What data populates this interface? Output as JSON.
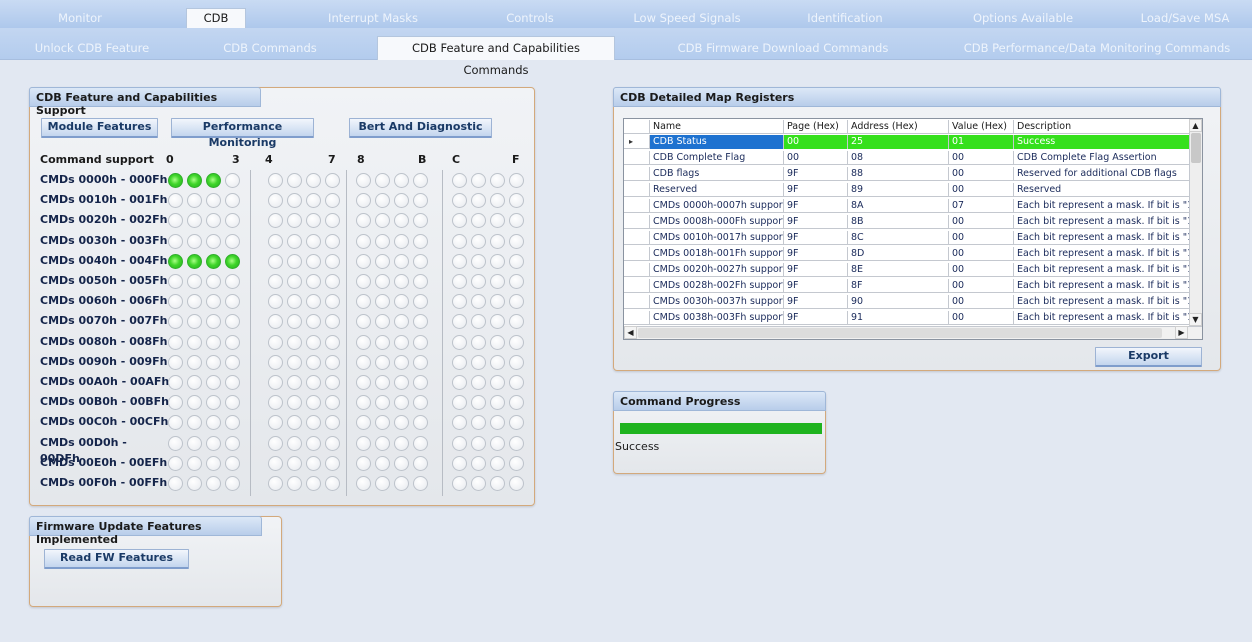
{
  "tabs_top": [
    "Monitor",
    "CDB",
    "Interrupt Masks",
    "Controls",
    "Low Speed Signals",
    "Identification",
    "Options Available",
    "Load/Save MSA"
  ],
  "tabs_sub": [
    "Unlock CDB Feature",
    "CDB Commands",
    "CDB Feature and Capabilities Commands",
    "CDB Firmware Download Commands",
    "CDB Performance/Data Monitoring Commands"
  ],
  "feature_panel": {
    "title": "CDB Feature and Capabilities Support",
    "buttons": [
      "Module Features",
      "Performance Monitoring",
      "Bert And Diagnostic"
    ],
    "header_label": "Command support",
    "col_headers": [
      "0",
      "3",
      "4",
      "7",
      "8",
      "B",
      "C",
      "F"
    ],
    "rows": [
      {
        "label": "CMDs 0000h - 000Fh",
        "bits": [
          1,
          1,
          1,
          0,
          0,
          0,
          0,
          0,
          0,
          0,
          0,
          0,
          0,
          0,
          0,
          0
        ]
      },
      {
        "label": "CMDs 0010h - 001Fh",
        "bits": [
          0,
          0,
          0,
          0,
          0,
          0,
          0,
          0,
          0,
          0,
          0,
          0,
          0,
          0,
          0,
          0
        ]
      },
      {
        "label": "CMDs 0020h - 002Fh",
        "bits": [
          0,
          0,
          0,
          0,
          0,
          0,
          0,
          0,
          0,
          0,
          0,
          0,
          0,
          0,
          0,
          0
        ]
      },
      {
        "label": "CMDs 0030h - 003Fh",
        "bits": [
          0,
          0,
          0,
          0,
          0,
          0,
          0,
          0,
          0,
          0,
          0,
          0,
          0,
          0,
          0,
          0
        ]
      },
      {
        "label": "CMDs 0040h - 004Fh",
        "bits": [
          1,
          1,
          1,
          1,
          0,
          0,
          0,
          0,
          0,
          0,
          0,
          0,
          0,
          0,
          0,
          0
        ]
      },
      {
        "label": "CMDs 0050h - 005Fh",
        "bits": [
          0,
          0,
          0,
          0,
          0,
          0,
          0,
          0,
          0,
          0,
          0,
          0,
          0,
          0,
          0,
          0
        ]
      },
      {
        "label": "CMDs 0060h - 006Fh",
        "bits": [
          0,
          0,
          0,
          0,
          0,
          0,
          0,
          0,
          0,
          0,
          0,
          0,
          0,
          0,
          0,
          0
        ]
      },
      {
        "label": "CMDs 0070h - 007Fh",
        "bits": [
          0,
          0,
          0,
          0,
          0,
          0,
          0,
          0,
          0,
          0,
          0,
          0,
          0,
          0,
          0,
          0
        ]
      },
      {
        "label": "CMDs 0080h - 008Fh",
        "bits": [
          0,
          0,
          0,
          0,
          0,
          0,
          0,
          0,
          0,
          0,
          0,
          0,
          0,
          0,
          0,
          0
        ]
      },
      {
        "label": "CMDs 0090h - 009Fh",
        "bits": [
          0,
          0,
          0,
          0,
          0,
          0,
          0,
          0,
          0,
          0,
          0,
          0,
          0,
          0,
          0,
          0
        ]
      },
      {
        "label": "CMDs 00A0h - 00AFh",
        "bits": [
          0,
          0,
          0,
          0,
          0,
          0,
          0,
          0,
          0,
          0,
          0,
          0,
          0,
          0,
          0,
          0
        ]
      },
      {
        "label": "CMDs 00B0h - 00BFh",
        "bits": [
          0,
          0,
          0,
          0,
          0,
          0,
          0,
          0,
          0,
          0,
          0,
          0,
          0,
          0,
          0,
          0
        ]
      },
      {
        "label": "CMDs 00C0h - 00CFh",
        "bits": [
          0,
          0,
          0,
          0,
          0,
          0,
          0,
          0,
          0,
          0,
          0,
          0,
          0,
          0,
          0,
          0
        ]
      },
      {
        "label": "CMDs 00D0h - 00DFh",
        "bits": [
          0,
          0,
          0,
          0,
          0,
          0,
          0,
          0,
          0,
          0,
          0,
          0,
          0,
          0,
          0,
          0
        ]
      },
      {
        "label": "CMDs 00E0h - 00EFh",
        "bits": [
          0,
          0,
          0,
          0,
          0,
          0,
          0,
          0,
          0,
          0,
          0,
          0,
          0,
          0,
          0,
          0
        ]
      },
      {
        "label": "CMDs 00F0h - 00FFh",
        "bits": [
          0,
          0,
          0,
          0,
          0,
          0,
          0,
          0,
          0,
          0,
          0,
          0,
          0,
          0,
          0,
          0
        ]
      }
    ]
  },
  "firmware_panel": {
    "title": "Firmware Update Features Implemented",
    "button": "Read FW Features"
  },
  "map_panel": {
    "title": "CDB Detailed Map Registers",
    "columns": [
      "Name",
      "Page (Hex)",
      "Address (Hex)",
      "Value (Hex)",
      "Description"
    ],
    "rows": [
      [
        "CDB Status",
        "00",
        "25",
        "01",
        "Success"
      ],
      [
        "CDB Complete Flag",
        "00",
        "08",
        "00",
        "CDB Complete Flag Assertion"
      ],
      [
        "CDB flags",
        "9F",
        "88",
        "00",
        "Reserved for additional CDB flags"
      ],
      [
        "Reserved",
        "9F",
        "89",
        "00",
        "Reserved"
      ],
      [
        "CMDs 0000h-0007h support",
        "9F",
        "8A",
        "07",
        "Each bit represent a mask. If bit is \"1"
      ],
      [
        "CMDs 0008h-000Fh support",
        "9F",
        "8B",
        "00",
        "Each bit represent a mask. If bit is \"1"
      ],
      [
        "CMDs 0010h-0017h support",
        "9F",
        "8C",
        "00",
        "Each bit represent a mask. If bit is \"1"
      ],
      [
        "CMDs 0018h-001Fh support",
        "9F",
        "8D",
        "00",
        "Each bit represent a mask. If bit is \"1"
      ],
      [
        "CMDs 0020h-0027h support",
        "9F",
        "8E",
        "00",
        "Each bit represent a mask. If bit is \"1"
      ],
      [
        "CMDs 0028h-002Fh support",
        "9F",
        "8F",
        "00",
        "Each bit represent a mask. If bit is \"1"
      ],
      [
        "CMDs 0030h-0037h support",
        "9F",
        "90",
        "00",
        "Each bit represent a mask. If bit is \"1"
      ],
      [
        "CMDs 0038h-003Fh support",
        "9F",
        "91",
        "00",
        "Each bit represent a mask. If bit is \"1"
      ]
    ],
    "export_button": "Export"
  },
  "progress_panel": {
    "title": "Command Progress",
    "progress": 1.0,
    "status": "Success"
  },
  "colors": {
    "led_on": "#3fd52a",
    "selected_name": "#1e72d0",
    "selected_row": "#35e01c",
    "progress": "#1fb31f"
  }
}
